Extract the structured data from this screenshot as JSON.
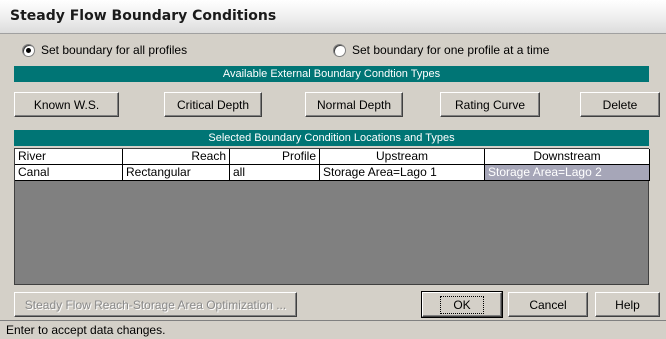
{
  "window": {
    "title": "Steady Flow Boundary Conditions"
  },
  "mode": {
    "all_profiles_label": "Set boundary for all profiles",
    "one_profile_label": "Set boundary for one profile at a time",
    "selected": "all"
  },
  "available_types": {
    "header": "Available External Boundary Condtion Types",
    "buttons": {
      "known_ws": "Known W.S.",
      "critical_depth": "Critical Depth",
      "normal_depth": "Normal Depth",
      "rating_curve": "Rating Curve",
      "delete": "Delete"
    }
  },
  "locations": {
    "header": "Selected Boundary Condition Locations and Types",
    "columns": [
      "River",
      "Reach",
      "Profile",
      "Upstream",
      "Downstream"
    ],
    "rows": [
      {
        "river": "Canal",
        "reach": "Rectangular",
        "profile": "all",
        "upstream": "Storage Area=Lago 1",
        "downstream": "Storage Area=Lago 2"
      }
    ]
  },
  "footer_buttons": {
    "optimization": "Steady Flow Reach-Storage Area Optimization ...",
    "ok": "OK",
    "cancel": "Cancel",
    "help": "Help"
  },
  "status": {
    "text": "Enter to accept data changes."
  }
}
